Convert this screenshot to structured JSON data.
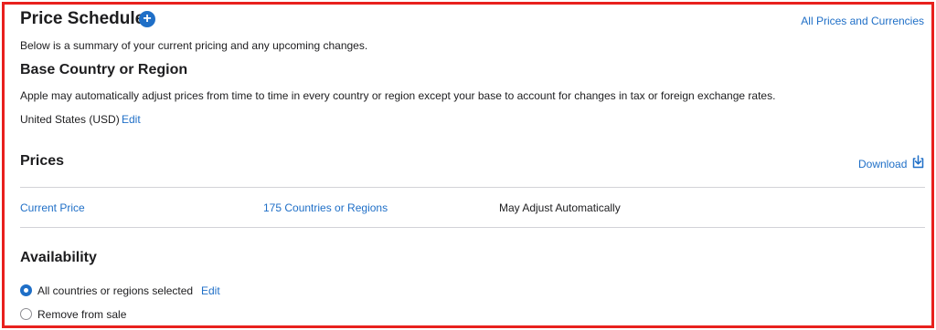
{
  "header": {
    "title": "Price Schedule",
    "add_icon": "plus-circle-icon",
    "all_prices_link": "All Prices and Currencies"
  },
  "summary_text": "Below is a summary of your current pricing and any upcoming changes.",
  "base_region": {
    "title": "Base Country or Region",
    "description": "Apple may automatically adjust prices from time to time in every country or region except your base to account for changes in tax or foreign exchange rates.",
    "value": "United States (USD)",
    "edit_label": "Edit"
  },
  "prices": {
    "title": "Prices",
    "download_label": "Download",
    "download_icon": "download-icon",
    "row": {
      "name": "Current Price",
      "regions": "175 Countries or Regions",
      "status": "May Adjust Automatically"
    }
  },
  "availability": {
    "title": "Availability",
    "options": [
      {
        "label": "All countries or regions selected",
        "selected": true,
        "edit_label": "Edit"
      },
      {
        "label": "Remove from sale",
        "selected": false
      }
    ]
  },
  "colors": {
    "accent": "#1f6fc7",
    "border_highlight": "#e8201d",
    "divider": "#d2d2d7",
    "text": "#1d1d1f"
  }
}
